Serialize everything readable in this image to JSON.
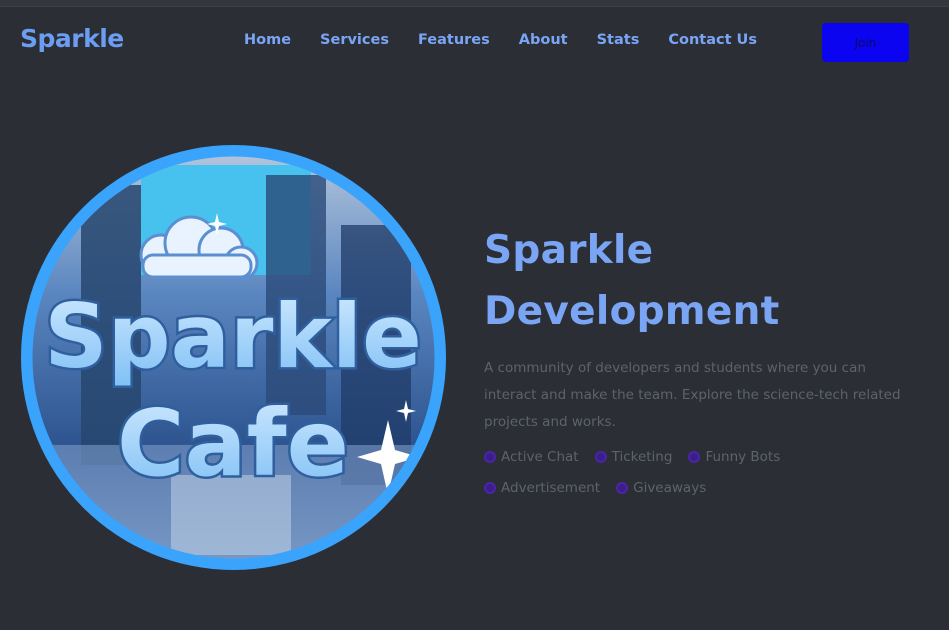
{
  "nav": {
    "brand": "Sparkle",
    "links": [
      "Home",
      "Services",
      "Features",
      "About",
      "Stats",
      "Contact Us"
    ],
    "join_label": "Join"
  },
  "hero": {
    "title_line1": "Sparkle",
    "title_line2": "Development",
    "description": "A community of developers and students where you can interact and make the team. Explore the science-tech related projects and works.",
    "features": [
      "Active Chat",
      "Ticketing",
      "Funny Bots",
      "Advertisement",
      "Giveaways"
    ],
    "feature_icon": "sparkle-dot-icon"
  },
  "logo": {
    "line1": "Sparkle",
    "line2": "Cafe"
  },
  "colors": {
    "background": "#2b2e35",
    "accent": "#7aa5f5",
    "button": "#0a04f0",
    "ring": "#3aa3fb",
    "muted_text": "#5e626c"
  }
}
